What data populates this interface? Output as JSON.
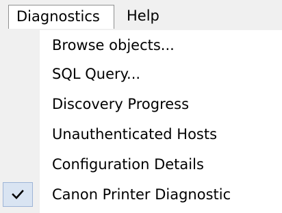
{
  "menubar": {
    "items": [
      {
        "label": "Diagnostics",
        "open": true
      },
      {
        "label": "Help",
        "open": false
      }
    ]
  },
  "dropdown": {
    "items": [
      {
        "label": "Browse objects...",
        "checked": false
      },
      {
        "label": "SQL Query...",
        "checked": false
      },
      {
        "label": "Discovery Progress",
        "checked": false
      },
      {
        "label": "Unauthenticated Hosts",
        "checked": false
      },
      {
        "label": "Configuration Details",
        "checked": false
      },
      {
        "label": "Canon Printer Diagnostic",
        "checked": true
      }
    ],
    "check_icon": "checkmark-icon"
  }
}
